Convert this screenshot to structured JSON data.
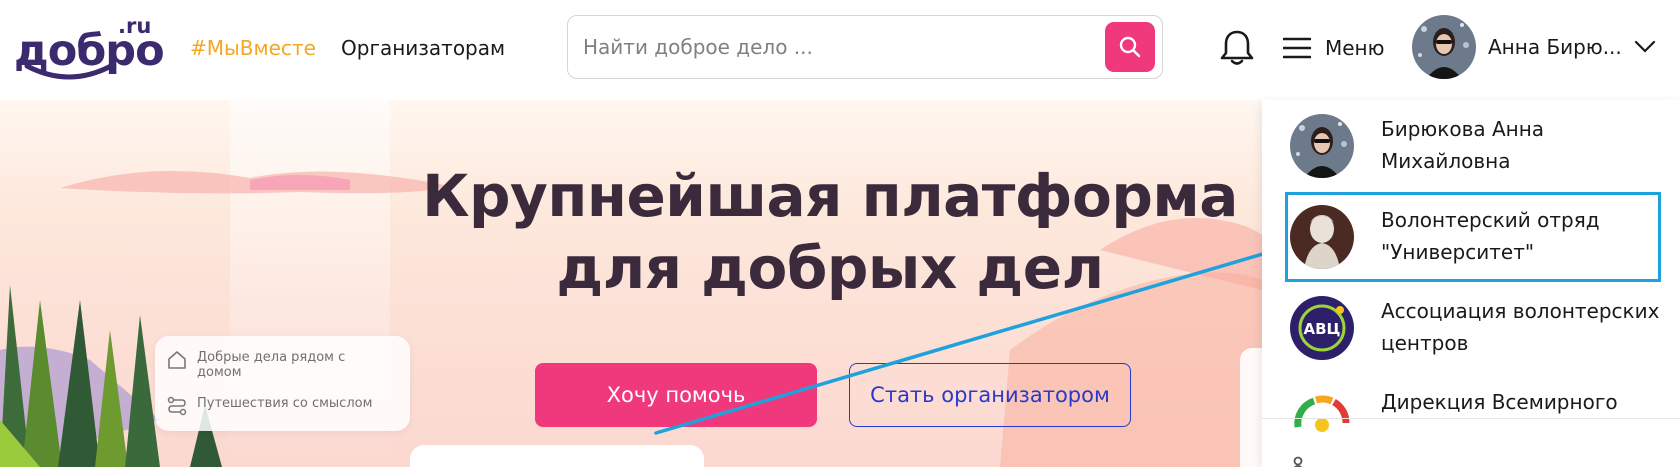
{
  "header": {
    "logo_word": "добро",
    "logo_suffix": ".ru",
    "nav": {
      "together": "#МыВместе",
      "organizers": "Организаторам"
    },
    "search": {
      "placeholder": "Найти доброе дело ..."
    },
    "menu_label": "Меню",
    "user_name": "Анна Бирю...",
    "icons": {
      "search": "search-icon",
      "bell": "bell-icon",
      "menu": "hamburger-icon",
      "chevron": "chevron-down-icon"
    }
  },
  "hero": {
    "title_line1": "Крупнейшая платформа",
    "title_line2": "для добрых дел",
    "help_button": "Хочу помочь",
    "organizer_button": "Стать организатором",
    "card": {
      "item1": "Добрые дела рядом с домом",
      "item2": "Путешествия со смыслом"
    }
  },
  "dropdown": {
    "accounts": [
      {
        "name": "Бирюкова Анна Михайловна",
        "avatar": "avatar-photo-user"
      },
      {
        "name": "Волонтерский отряд \"Университет\"",
        "avatar": "avatar-statue",
        "highlighted": true
      },
      {
        "name": "Ассоциация волонтерских центров",
        "avatar": "avatar-avc-logo",
        "logo_text": "АВЦ"
      },
      {
        "name": "Дирекция Всемирного",
        "avatar": "avatar-colorful-logo"
      }
    ]
  },
  "colors": {
    "brand": "#3b2a6d",
    "accent_pink": "#f0387c",
    "accent_orange": "#f5a623",
    "outline_blue": "#2a39c9",
    "highlight": "#1ea1dc"
  }
}
